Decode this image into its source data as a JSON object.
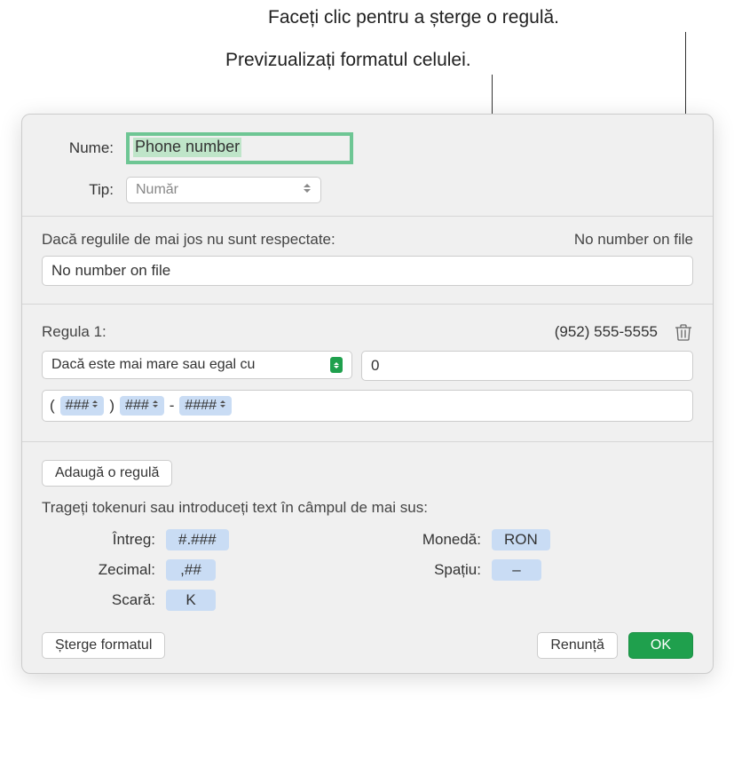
{
  "annotations": {
    "deleteRule": "Faceți clic pentru a șterge o regulă.",
    "previewFormat": "Previzualizați formatul celulei."
  },
  "labels": {
    "name": "Nume:",
    "type": "Tip:"
  },
  "fields": {
    "nameValue": "Phone number",
    "typeValue": "Număr"
  },
  "fallback": {
    "label": "Dacă regulile de mai jos nu sunt respectate:",
    "preview": "No number on file",
    "value": "No number on file"
  },
  "rule": {
    "title": "Regula 1:",
    "preview": "(952) 555-5555",
    "conditionLabel": "Dacă este mai mare sau egal cu",
    "conditionValue": "0",
    "tokens": {
      "t1": "###",
      "t2": "###",
      "t3": "####",
      "open": "(",
      "close": ")",
      "dash": "-"
    }
  },
  "buttons": {
    "addRule": "Adaugă o regulă",
    "deleteFormat": "Șterge formatul",
    "cancel": "Renunță",
    "ok": "OK"
  },
  "tokenHint": "Trageți tokenuri sau introduceți text în câmpul de mai sus:",
  "tokenGrid": {
    "integer": {
      "label": "Întreg:",
      "value": "#.###"
    },
    "decimal": {
      "label": "Zecimal:",
      "value": ",##"
    },
    "scale": {
      "label": "Scară:",
      "value": "K"
    },
    "currency": {
      "label": "Monedă:",
      "value": "RON"
    },
    "space": {
      "label": "Spațiu:",
      "value": "–"
    }
  }
}
